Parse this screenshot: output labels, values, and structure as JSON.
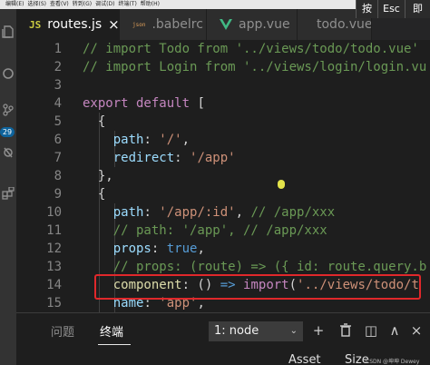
{
  "menubar": [
    "编辑(E)",
    "选择(S)",
    "查看(V)",
    "转到(G)",
    "调试(D)",
    "终端(T)",
    "帮助(H)"
  ],
  "activity": {
    "badge": "29"
  },
  "tabs": [
    {
      "label": "routes.js",
      "icon": "JS",
      "close": "×"
    },
    {
      "label": ".babelrc",
      "icon": "json"
    },
    {
      "label": "app.vue"
    },
    {
      "label": "todo.vue"
    }
  ],
  "ime": {
    "key1": "按",
    "key2": "Esc",
    "key3": "即"
  },
  "editor": {
    "lines": [
      {
        "n": "1",
        "parts": [
          {
            "t": "// import Todo from '../views/todo/todo.vue'",
            "c": "cm"
          }
        ]
      },
      {
        "n": "2",
        "parts": [
          {
            "t": "// import Login from '../views/login/login.vu",
            "c": "cm"
          }
        ]
      },
      {
        "n": "3",
        "parts": []
      },
      {
        "n": "4",
        "parts": [
          {
            "t": "export default ",
            "c": "kw"
          },
          {
            "t": "[",
            "c": "pn"
          }
        ]
      },
      {
        "n": "5",
        "parts": [
          {
            "t": "  {",
            "c": "pn"
          }
        ]
      },
      {
        "n": "6",
        "parts": [
          {
            "t": "    path",
            "c": "pr"
          },
          {
            "t": ": ",
            "c": "pn"
          },
          {
            "t": "'/'",
            "c": "st"
          },
          {
            "t": ",",
            "c": "pn"
          }
        ]
      },
      {
        "n": "7",
        "parts": [
          {
            "t": "    redirect",
            "c": "pr"
          },
          {
            "t": ": ",
            "c": "pn"
          },
          {
            "t": "'/app'",
            "c": "st"
          }
        ]
      },
      {
        "n": "8",
        "parts": [
          {
            "t": "  },",
            "c": "pn"
          }
        ]
      },
      {
        "n": "9",
        "parts": [
          {
            "t": "  {",
            "c": "pn"
          }
        ]
      },
      {
        "n": "10",
        "parts": [
          {
            "t": "    path",
            "c": "pr"
          },
          {
            "t": ": ",
            "c": "pn"
          },
          {
            "t": "'/app/:id'",
            "c": "st"
          },
          {
            "t": ", ",
            "c": "pn"
          },
          {
            "t": "// /app/xxx",
            "c": "cm"
          }
        ]
      },
      {
        "n": "11",
        "parts": [
          {
            "t": "    // path: '/app', // /app/xxx",
            "c": "cm"
          }
        ]
      },
      {
        "n": "12",
        "parts": [
          {
            "t": "    props",
            "c": "pr"
          },
          {
            "t": ": ",
            "c": "pn"
          },
          {
            "t": "true",
            "c": "bl"
          },
          {
            "t": ",",
            "c": "pn"
          }
        ]
      },
      {
        "n": "13",
        "parts": [
          {
            "t": "    // props: (route) => ({ id: route.query.b",
            "c": "cm"
          }
        ]
      },
      {
        "n": "14",
        "parts": [
          {
            "t": "    component",
            "c": "fn"
          },
          {
            "t": ": () ",
            "c": "pn"
          },
          {
            "t": "=>",
            "c": "bl"
          },
          {
            "t": " ",
            "c": "pn"
          },
          {
            "t": "import",
            "c": "kw"
          },
          {
            "t": "(",
            "c": "pn"
          },
          {
            "t": "'../views/todo/t",
            "c": "st"
          }
        ]
      },
      {
        "n": "15",
        "parts": [
          {
            "t": "    name",
            "c": "pr"
          },
          {
            "t": ": ",
            "c": "pn"
          },
          {
            "t": "'app'",
            "c": "st"
          },
          {
            "t": ",",
            "c": "pn"
          }
        ]
      }
    ]
  },
  "panel": {
    "tabs": [
      "问题",
      "终端"
    ],
    "terminal_select": "1: node",
    "chevron": "⌄",
    "tools": {
      "add": "+",
      "split": "◫",
      "maximize": "∧",
      "close": "×"
    },
    "bottom_text": "Asset",
    "bottom_size": "Size",
    "watermark": "CSDN @坤坤 Dewey"
  },
  "colors": {
    "accent": "#0e639c",
    "highlight": "#e0282b",
    "background": "#1e1e1e"
  }
}
